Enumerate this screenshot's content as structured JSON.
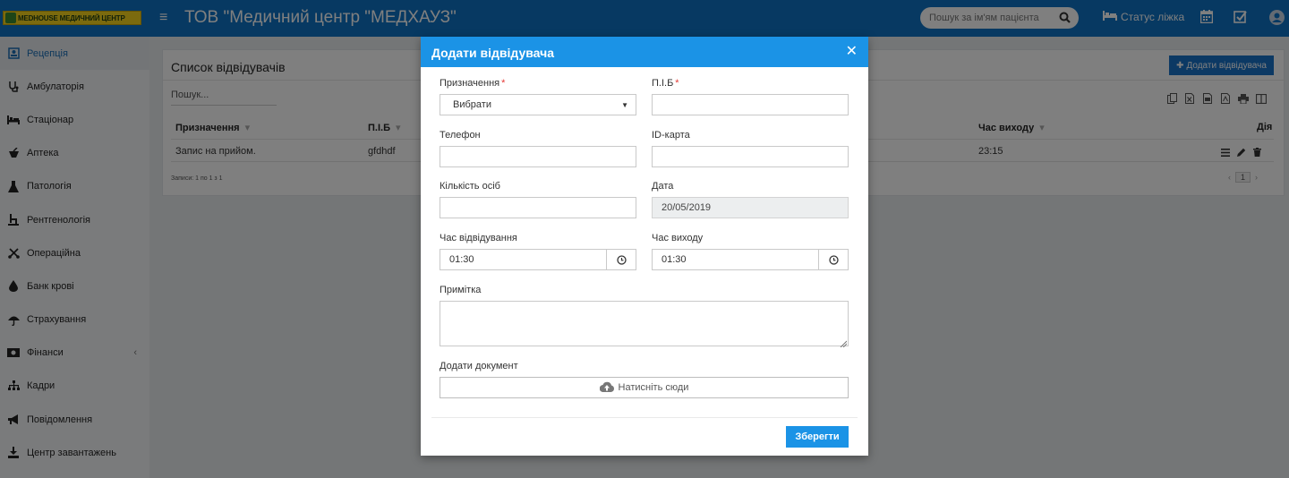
{
  "header": {
    "logo_text": "MEDHOUSE МЕДИЧНИЙ ЦЕНТР",
    "title": "ТОВ \"Медичний центр \"МЕДХАУЗ\"",
    "search_placeholder": "Пошук за ім'ям пацієнта",
    "bed_status_label": "Статус ліжка",
    "icons": [
      "menu-icon",
      "search-icon",
      "bed-icon",
      "calendar-icon",
      "checkbox-icon",
      "user-avatar-icon"
    ]
  },
  "sidebar": {
    "items": [
      {
        "label": "Рецепція",
        "icon": "reception-icon",
        "active": true
      },
      {
        "label": "Амбулаторія",
        "icon": "stethoscope-icon"
      },
      {
        "label": "Стаціонар",
        "icon": "bed-icon"
      },
      {
        "label": "Аптека",
        "icon": "pharmacy-icon"
      },
      {
        "label": "Патологія",
        "icon": "flask-icon"
      },
      {
        "label": "Рентгенологія",
        "icon": "xray-icon"
      },
      {
        "label": "Операційна",
        "icon": "scissors-icon"
      },
      {
        "label": "Банк крові",
        "icon": "blood-drop-icon"
      },
      {
        "label": "Страхування",
        "icon": "umbrella-icon"
      },
      {
        "label": "Фінанси",
        "icon": "money-icon",
        "has_submenu": true
      },
      {
        "label": "Кадри",
        "icon": "org-chart-icon"
      },
      {
        "label": "Повідомлення",
        "icon": "megaphone-icon"
      },
      {
        "label": "Центр завантажень",
        "icon": "download-icon"
      }
    ]
  },
  "list": {
    "title": "Список відвідувачів",
    "add_button": "Додати відвідувача",
    "search_placeholder": "Пошук...",
    "columns": [
      "Призначення",
      "П.І.Б",
      "Час виходу",
      "Дія"
    ],
    "rows": [
      {
        "purpose": "Запис на прийом.",
        "name": "gfdhdf",
        "exit_time": "23:15"
      }
    ],
    "records_info": "Записи: 1 по 1 з 1",
    "page": "1"
  },
  "modal": {
    "title": "Додати відвідувача",
    "fields": {
      "purpose": {
        "label": "Призначення",
        "required": true,
        "value": "Вибрати"
      },
      "name": {
        "label": "П.І.Б",
        "required": true,
        "value": ""
      },
      "phone": {
        "label": "Телефон",
        "value": ""
      },
      "id_card": {
        "label": "ID-карта",
        "value": ""
      },
      "people_count": {
        "label": "Кількість осіб",
        "value": ""
      },
      "date": {
        "label": "Дата",
        "value": "20/05/2019"
      },
      "visit_time": {
        "label": "Час відвідування",
        "value": "01:30"
      },
      "exit_time": {
        "label": "Час виходу",
        "value": "01:30"
      },
      "note": {
        "label": "Примітка",
        "value": ""
      },
      "document": {
        "label": "Додати документ",
        "button": "Натисніть сюди"
      }
    },
    "save_button": "Зберегти"
  },
  "colors": {
    "header_bg": "#0f73c4",
    "modal_header": "#1b93e6",
    "primary_button": "#1b93e6",
    "required_mark": "#e53935"
  }
}
